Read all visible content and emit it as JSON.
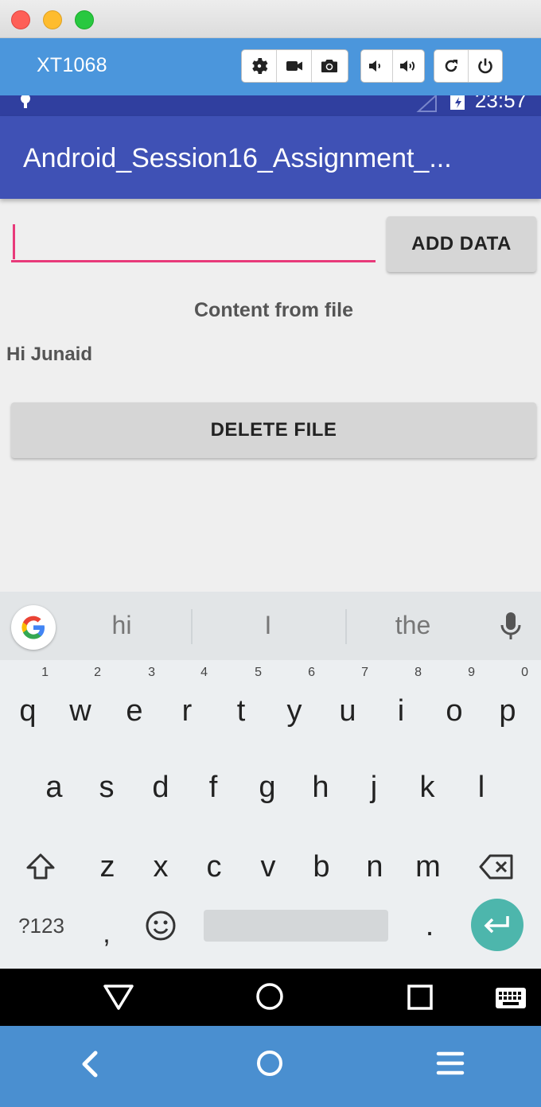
{
  "window": {
    "device_name": "XT1068"
  },
  "status_bar": {
    "time": "23:57"
  },
  "app": {
    "title": "Android_Session16_Assignment_...",
    "input_value": "",
    "add_button": "ADD DATA",
    "content_heading": "Content from file",
    "file_content": "Hi Junaid",
    "delete_button": "DELETE FILE"
  },
  "keyboard": {
    "suggestions": [
      "hi",
      "I",
      "the"
    ],
    "row1": [
      "q",
      "w",
      "e",
      "r",
      "t",
      "y",
      "u",
      "i",
      "o",
      "p"
    ],
    "row1_hints": [
      "1",
      "2",
      "3",
      "4",
      "5",
      "6",
      "7",
      "8",
      "9",
      "0"
    ],
    "row2": [
      "a",
      "s",
      "d",
      "f",
      "g",
      "h",
      "j",
      "k",
      "l"
    ],
    "row3": [
      "z",
      "x",
      "c",
      "v",
      "b",
      "n",
      "m"
    ],
    "symbols_key": "?123",
    "comma_key": ",",
    "period_key": "."
  },
  "colors": {
    "vysor_toolbar": "#4b96dc",
    "app_bar": "#3f51b5",
    "status_bar": "#303f9f",
    "input_accent": "#e83a7a",
    "enter_key": "#4db6ac"
  }
}
